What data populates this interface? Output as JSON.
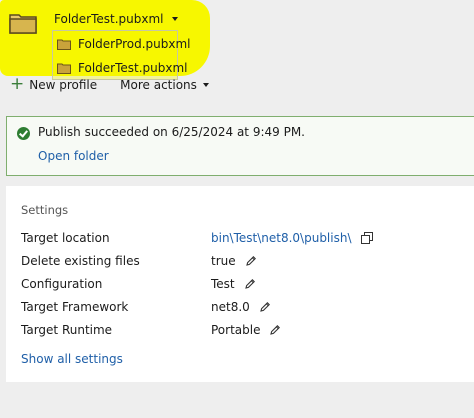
{
  "header": {
    "selected_profile": "FolderTest.pubxml",
    "dropdown_items": [
      {
        "label": "FolderProd.pubxml"
      },
      {
        "label": "FolderTest.pubxml"
      }
    ]
  },
  "toolbar": {
    "new_profile_label": "New profile",
    "more_actions_label": "More actions"
  },
  "status": {
    "message": "Publish succeeded on 6/25/2024 at 9:49 PM.",
    "open_folder_label": "Open folder"
  },
  "settings": {
    "title": "Settings",
    "rows": [
      {
        "label": "Target location",
        "value": "bin\\Test\\net8.0\\publish\\"
      },
      {
        "label": "Delete existing files",
        "value": "true"
      },
      {
        "label": "Configuration",
        "value": "Test"
      },
      {
        "label": "Target Framework",
        "value": "net8.0"
      },
      {
        "label": "Target Runtime",
        "value": "Portable"
      }
    ],
    "show_all_label": "Show all settings"
  },
  "colors": {
    "highlight": "#f7f700",
    "success_border": "#7fae6e",
    "success_icon": "#2e7d32",
    "link": "#1f5fa8",
    "folder": "#c9a33b"
  },
  "icons": [
    "folder-icon",
    "chevron-down-icon",
    "plus-icon",
    "check-circle-icon",
    "copy-icon",
    "edit-icon"
  ]
}
